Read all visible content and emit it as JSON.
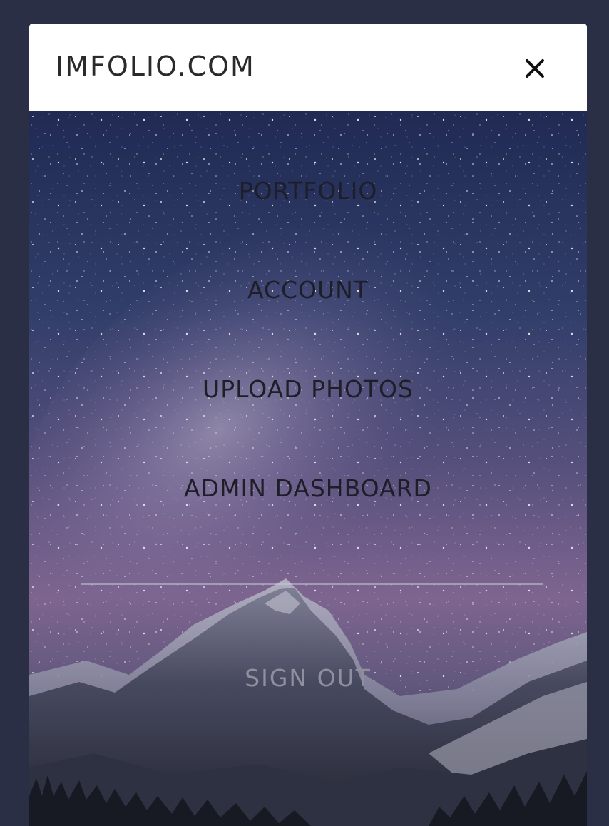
{
  "header": {
    "brand": "IMFOLIO.COM",
    "close_icon": "close-icon"
  },
  "menu": {
    "items": [
      {
        "label": "PORTFOLIO"
      },
      {
        "label": "ACCOUNT"
      },
      {
        "label": "UPLOAD PHOTOS"
      },
      {
        "label": "ADMIN DASHBOARD"
      }
    ],
    "sign_out": "SIGN OUT"
  },
  "colors": {
    "page_background": "#2b2f45",
    "header_background": "#ffffff",
    "menu_text": "#1e1e28",
    "sign_out_text": "#8f8f9e"
  },
  "background_image": "starry-night-mountain"
}
